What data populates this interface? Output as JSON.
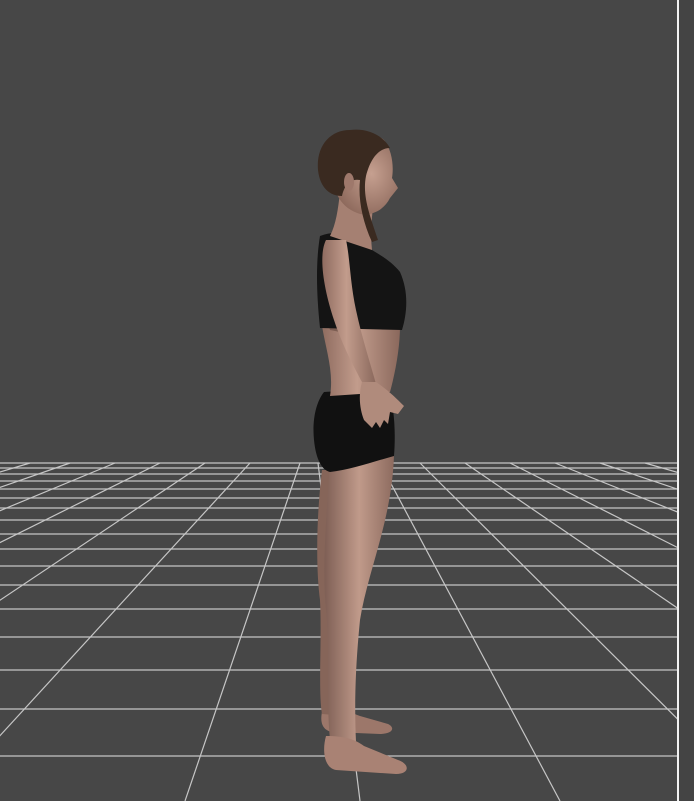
{
  "viewport": {
    "background_color": "#474747",
    "grid_color": "#d8d8d8",
    "divider_color": "#f2f2f2",
    "figure": {
      "skin_color": "#b48e80",
      "clothing_color": "#121212",
      "hair_color": "#3a2a20"
    }
  }
}
